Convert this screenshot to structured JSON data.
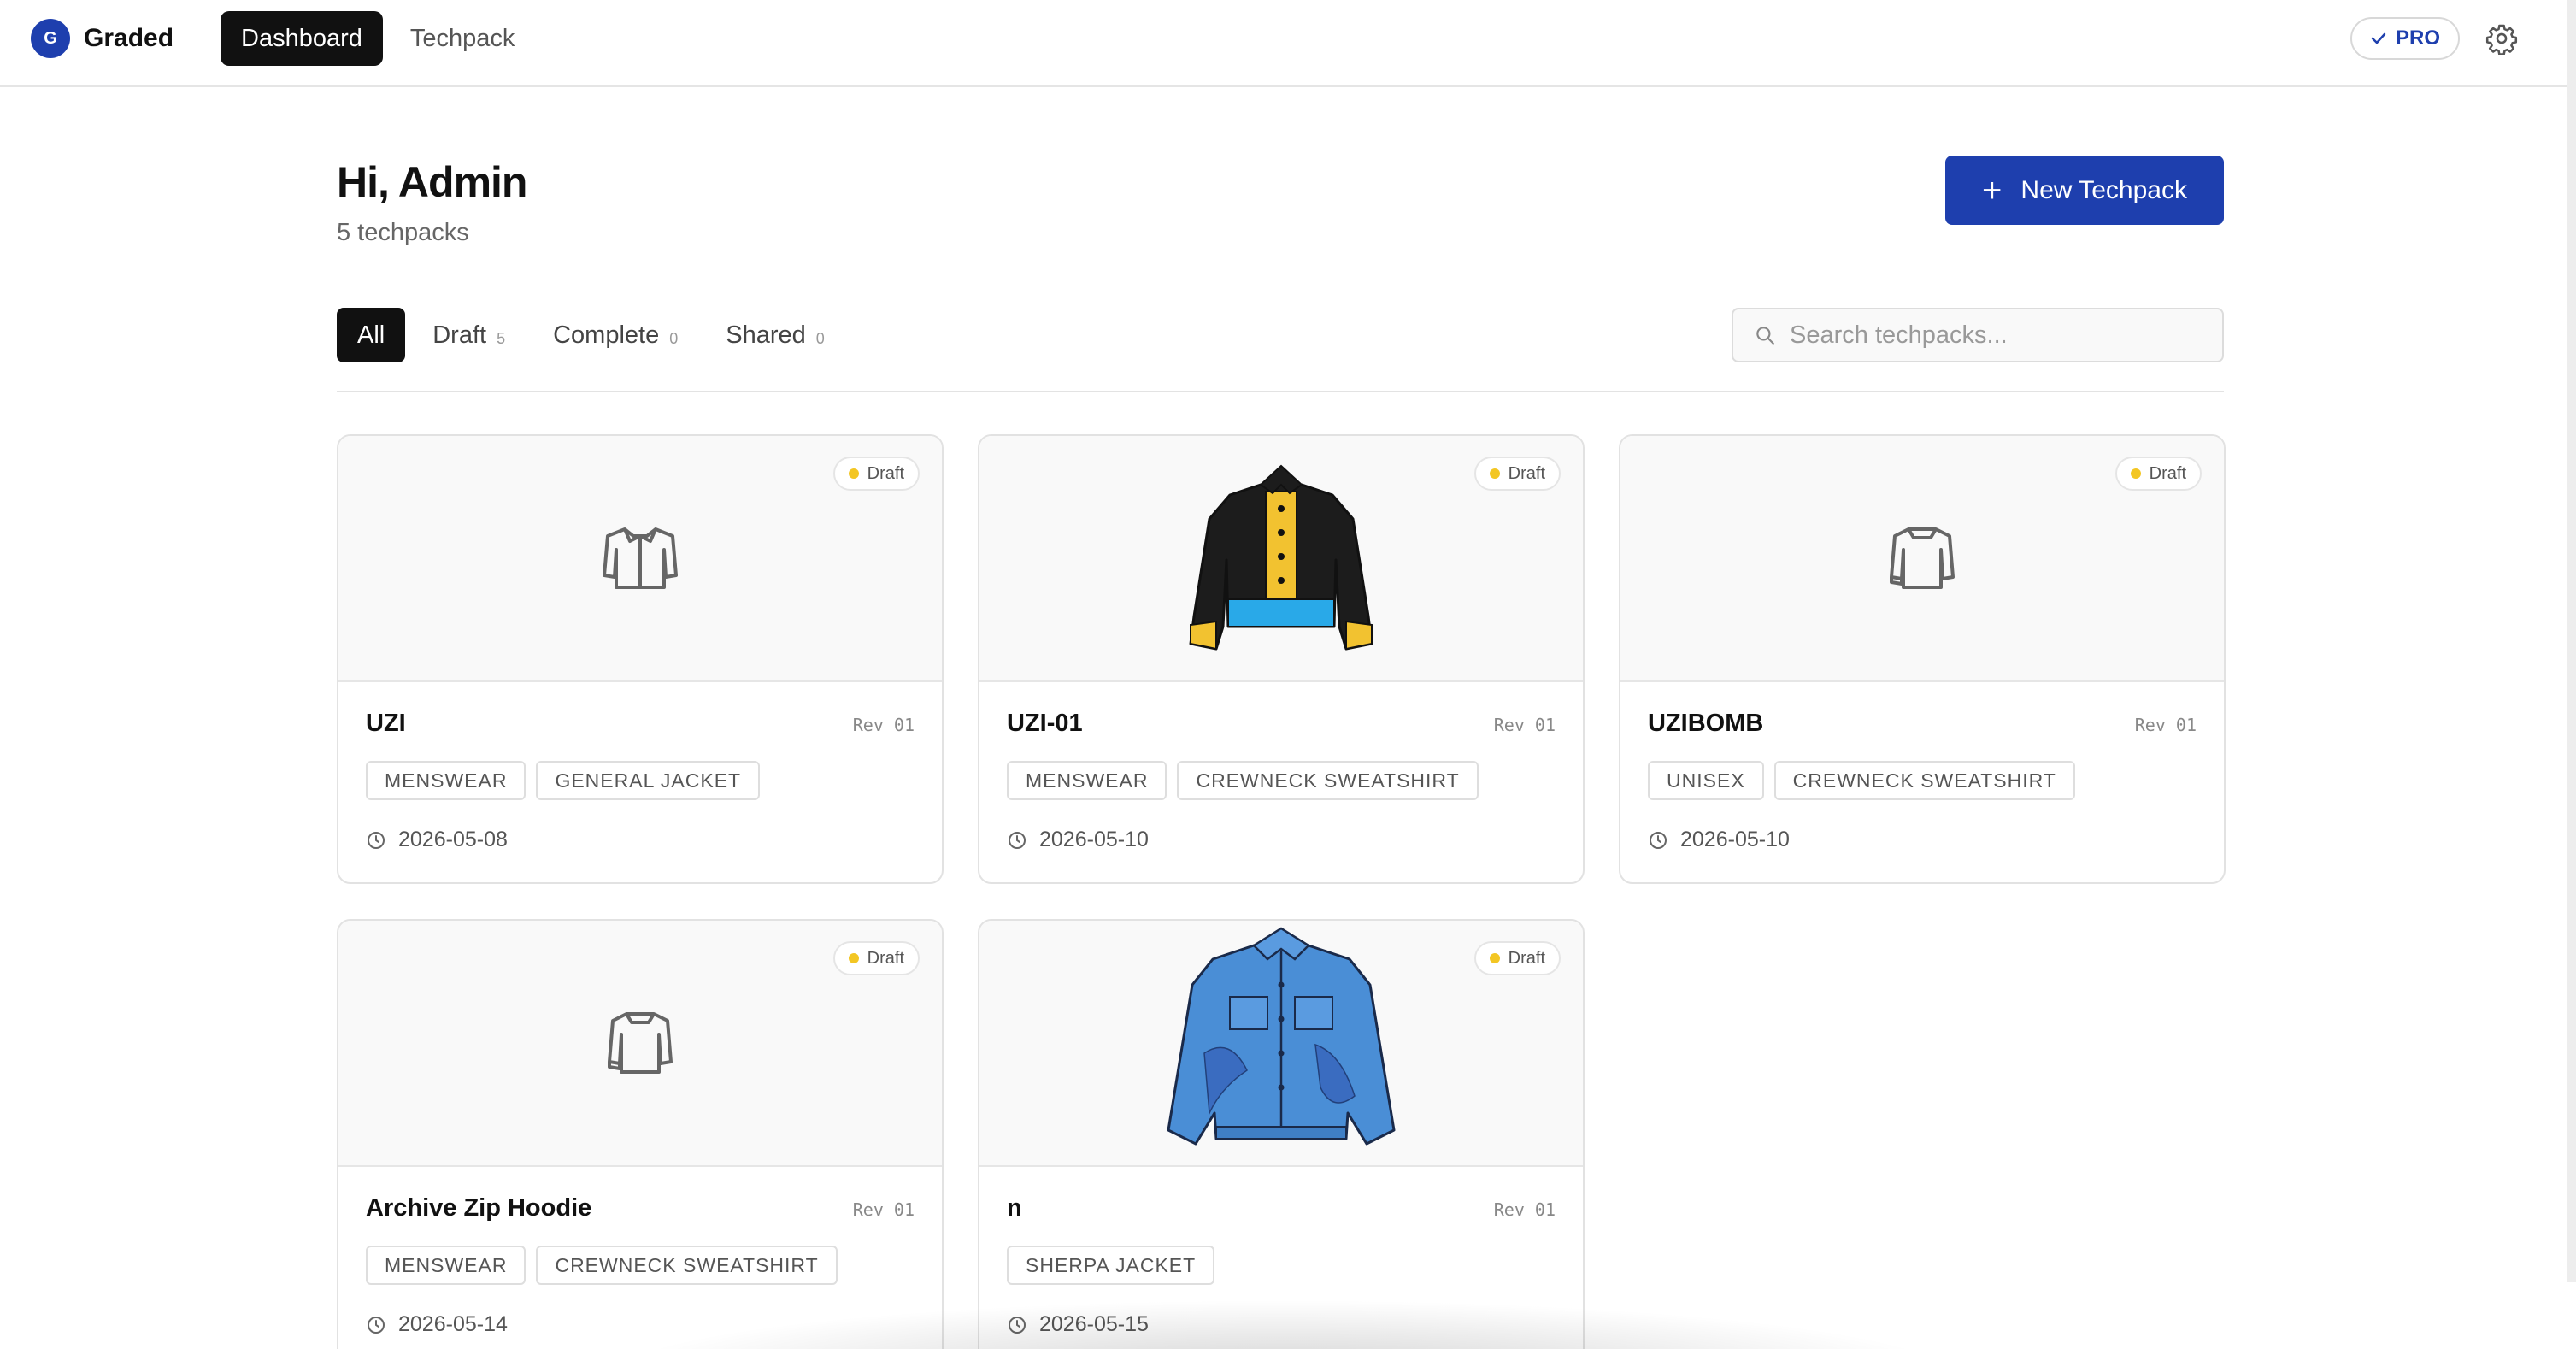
{
  "app": {
    "logo_letter": "G",
    "name": "Graded",
    "brand_color": "#1e3fae"
  },
  "nav": {
    "items": [
      {
        "label": "Dashboard",
        "active": true
      },
      {
        "label": "Techpack",
        "active": false
      }
    ]
  },
  "pro": {
    "label": "PRO",
    "check_icon": "check-icon"
  },
  "header": {
    "greeting": "Hi, Admin",
    "count": "5 techpacks",
    "new_button": "New Techpack"
  },
  "filters": [
    {
      "label": "All",
      "count": "",
      "active": true
    },
    {
      "label": "Draft",
      "count": "5",
      "active": false
    },
    {
      "label": "Complete",
      "count": "0",
      "active": false
    },
    {
      "label": "Shared",
      "count": "0",
      "active": false
    }
  ],
  "search": {
    "placeholder": "Search techpacks...",
    "value": ""
  },
  "cards": [
    {
      "name": "UZI",
      "rev": "Rev 01",
      "status": "Draft",
      "tags": [
        "MENSWEAR",
        "GENERAL JACKET"
      ],
      "date": "2026-05-08",
      "image": "shirt-placeholder-icon"
    },
    {
      "name": "UZI-01",
      "rev": "Rev 01",
      "status": "Draft",
      "tags": [
        "MENSWEAR",
        "CREWNECK SWEATSHIRT"
      ],
      "date": "2026-05-10",
      "image": "black-yellow-jacket"
    },
    {
      "name": "UZIBOMB",
      "rev": "Rev 01",
      "status": "Draft",
      "tags": [
        "UNISEX",
        "CREWNECK SWEATSHIRT"
      ],
      "date": "2026-05-10",
      "image": "sweatshirt-placeholder-icon"
    },
    {
      "name": "Archive Zip Hoodie",
      "rev": "Rev 01",
      "status": "Draft",
      "tags": [
        "MENSWEAR",
        "CREWNECK SWEATSHIRT"
      ],
      "date": "2026-05-14",
      "image": "sweatshirt-placeholder-icon"
    },
    {
      "name": "n",
      "rev": "Rev 01",
      "status": "Draft",
      "tags": [
        "SHERPA JACKET"
      ],
      "date": "2026-05-15",
      "image": "denim-jacket"
    }
  ]
}
